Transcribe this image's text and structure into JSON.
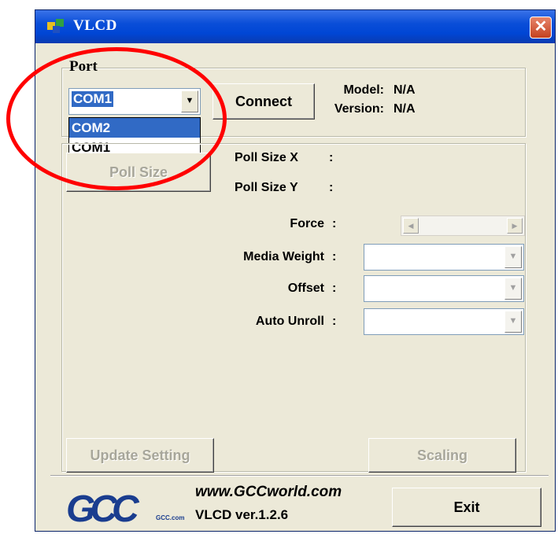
{
  "window": {
    "title": "VLCD",
    "close_glyph": "✕"
  },
  "port": {
    "label": "Port",
    "selected": "COM1",
    "options": [
      "COM2",
      "COM1"
    ],
    "connect_label": "Connect",
    "model_label": "Model:",
    "model_value": "N/A",
    "version_label": "Version:",
    "version_value": "N/A"
  },
  "settings": {
    "poll_size_button": "Poll Size",
    "poll_size_x_label": "Poll Size X",
    "poll_size_y_label": "Poll Size Y",
    "force_label": "Force",
    "media_weight_label": "Media Weight",
    "offset_label": "Offset",
    "auto_unroll_label": "Auto Unroll",
    "colon": ":"
  },
  "buttons": {
    "update_setting": "Update Setting",
    "scaling": "Scaling",
    "exit": "Exit"
  },
  "footer": {
    "url": "www.GCCworld.com",
    "version": "VLCD ver.1.2.6",
    "logo": "GCC",
    "logo_sub": "GCC.com"
  },
  "colors": {
    "titlebar": "#0046d5",
    "window_bg": "#ece9d8",
    "highlight": "#ff0000",
    "selection": "#316ac5"
  },
  "icons": [
    "app-icon",
    "close-icon",
    "chevron-down-icon",
    "scroll-left-icon",
    "scroll-right-icon"
  ]
}
